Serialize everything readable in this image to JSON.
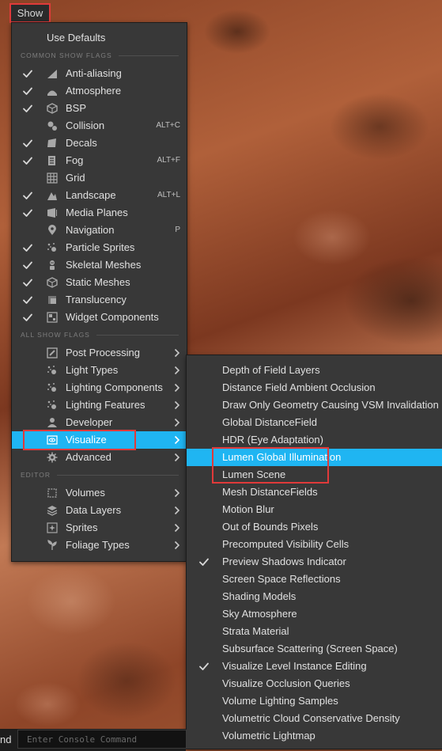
{
  "show_button": {
    "label": "Show"
  },
  "main_menu": {
    "use_defaults": "Use Defaults",
    "section_common": "COMMON SHOW FLAGS",
    "common_flags": [
      {
        "label": "Anti-aliasing",
        "checked": true,
        "shortcut": "",
        "icon": "antialias-icon"
      },
      {
        "label": "Atmosphere",
        "checked": true,
        "shortcut": "",
        "icon": "atmosphere-icon"
      },
      {
        "label": "BSP",
        "checked": true,
        "shortcut": "",
        "icon": "bsp-icon"
      },
      {
        "label": "Collision",
        "checked": false,
        "shortcut": "ALT+C",
        "icon": "collision-icon"
      },
      {
        "label": "Decals",
        "checked": true,
        "shortcut": "",
        "icon": "decals-icon"
      },
      {
        "label": "Fog",
        "checked": true,
        "shortcut": "ALT+F",
        "icon": "fog-icon"
      },
      {
        "label": "Grid",
        "checked": false,
        "shortcut": "",
        "icon": "grid-icon"
      },
      {
        "label": "Landscape",
        "checked": true,
        "shortcut": "ALT+L",
        "icon": "landscape-icon"
      },
      {
        "label": "Media Planes",
        "checked": true,
        "shortcut": "",
        "icon": "media-planes-icon"
      },
      {
        "label": "Navigation",
        "checked": false,
        "shortcut": "P",
        "icon": "navigation-icon"
      },
      {
        "label": "Particle Sprites",
        "checked": true,
        "shortcut": "",
        "icon": "particle-sprites-icon"
      },
      {
        "label": "Skeletal Meshes",
        "checked": true,
        "shortcut": "",
        "icon": "skeletal-meshes-icon"
      },
      {
        "label": "Static Meshes",
        "checked": true,
        "shortcut": "",
        "icon": "static-meshes-icon"
      },
      {
        "label": "Translucency",
        "checked": true,
        "shortcut": "",
        "icon": "translucency-icon"
      },
      {
        "label": "Widget Components",
        "checked": true,
        "shortcut": "",
        "icon": "widget-components-icon"
      }
    ],
    "section_all": "ALL SHOW FLAGS",
    "all_flags": [
      {
        "label": "Post Processing",
        "icon": "post-processing-icon"
      },
      {
        "label": "Light Types",
        "icon": "light-types-icon"
      },
      {
        "label": "Lighting Components",
        "icon": "lighting-components-icon"
      },
      {
        "label": "Lighting Features",
        "icon": "lighting-features-icon"
      },
      {
        "label": "Developer",
        "icon": "developer-icon"
      },
      {
        "label": "Visualize",
        "icon": "visualize-icon",
        "highlighted": true
      },
      {
        "label": "Advanced",
        "icon": "advanced-icon"
      }
    ],
    "section_editor": "EDITOR",
    "editor_flags": [
      {
        "label": "Volumes",
        "icon": "volumes-icon"
      },
      {
        "label": "Data Layers",
        "icon": "data-layers-icon"
      },
      {
        "label": "Sprites",
        "icon": "sprites-icon"
      },
      {
        "label": "Foliage Types",
        "icon": "foliage-types-icon"
      }
    ]
  },
  "visualize_submenu": {
    "items": [
      {
        "label": "Depth of Field Layers",
        "checked": false
      },
      {
        "label": "Distance Field Ambient Occlusion",
        "checked": false
      },
      {
        "label": "Draw Only Geometry Causing VSM Invalidation",
        "checked": false
      },
      {
        "label": "Global DistanceField",
        "checked": false
      },
      {
        "label": "HDR (Eye Adaptation)",
        "checked": false
      },
      {
        "label": "Lumen Global Illumination",
        "checked": false,
        "highlighted": true
      },
      {
        "label": "Lumen Scene",
        "checked": false
      },
      {
        "label": "Mesh DistanceFields",
        "checked": false
      },
      {
        "label": "Motion Blur",
        "checked": false
      },
      {
        "label": "Out of Bounds Pixels",
        "checked": false
      },
      {
        "label": "Precomputed Visibility Cells",
        "checked": false
      },
      {
        "label": "Preview Shadows Indicator",
        "checked": true
      },
      {
        "label": "Screen Space Reflections",
        "checked": false
      },
      {
        "label": "Shading Models",
        "checked": false
      },
      {
        "label": "Sky Atmosphere",
        "checked": false
      },
      {
        "label": "Strata Material",
        "checked": false
      },
      {
        "label": "Subsurface Scattering (Screen Space)",
        "checked": false
      },
      {
        "label": "Visualize Level Instance Editing",
        "checked": true
      },
      {
        "label": "Visualize Occlusion Queries",
        "checked": false
      },
      {
        "label": "Volume Lighting Samples",
        "checked": false
      },
      {
        "label": "Volumetric Cloud Conservative Density",
        "checked": false
      },
      {
        "label": "Volumetric Lightmap",
        "checked": false
      }
    ]
  },
  "console": {
    "cut_text": "nd",
    "placeholder": "Enter Console Command"
  },
  "colors": {
    "menu_bg": "#383838",
    "highlight": "#1fb5f2",
    "annotation": "#e03a3a"
  }
}
